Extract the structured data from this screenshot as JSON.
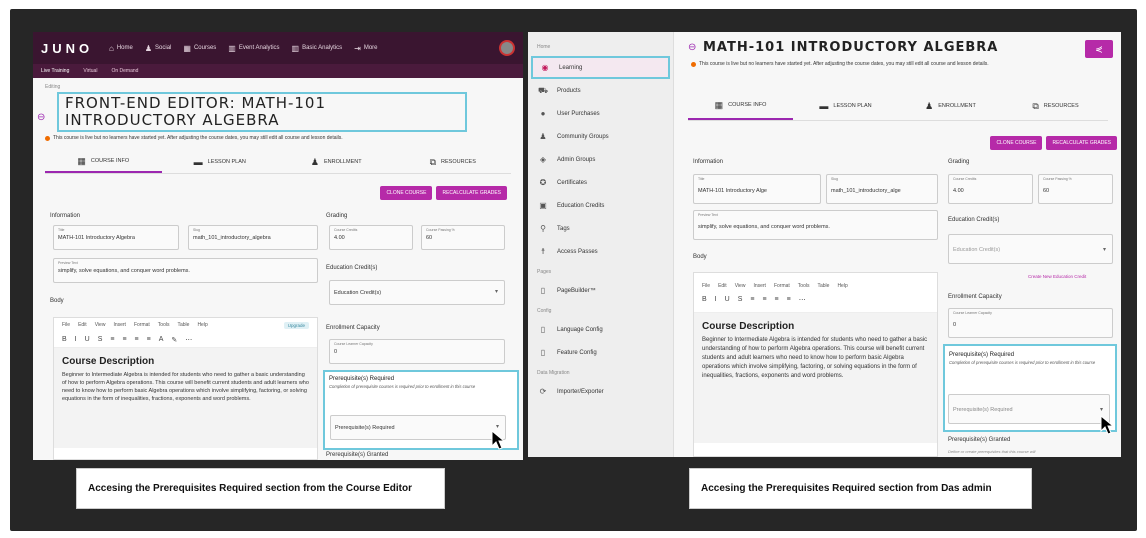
{
  "left": {
    "logo": "JUNO",
    "nav": [
      {
        "icon": "home-icon",
        "glyph": "⌂",
        "label": "Home"
      },
      {
        "icon": "people-icon",
        "glyph": "♟",
        "label": "Social"
      },
      {
        "icon": "calendar-icon",
        "glyph": "▦",
        "label": "Courses"
      },
      {
        "icon": "chart-icon",
        "glyph": "▥",
        "label": "Event Analytics"
      },
      {
        "icon": "bar-icon",
        "glyph": "▥",
        "label": "Basic Analytics"
      },
      {
        "icon": "more-icon",
        "glyph": "⇥",
        "label": "More"
      }
    ],
    "subnav": [
      "Live Training",
      "Virtual",
      "On Demand"
    ],
    "editing_label": "Editing",
    "title": "FRONT-END EDITOR: MATH-101 INTRODUCTORY ALGEBRA",
    "notice": "This course is live but no learners have started yet. After adjusting the course dates, you may still edit all course and lesson details.",
    "tabs": [
      "COURSE INFO",
      "LESSON PLAN",
      "ENROLLMENT",
      "RESOURCES"
    ],
    "buttons": {
      "clone": "CLONE COURSE",
      "recalc": "RECALCULATE GRADES"
    },
    "information": "Information",
    "title_field": {
      "label": "Title",
      "value": "MATH-101 Introductory Algebra"
    },
    "slug_field": {
      "label": "Slug",
      "value": "math_101_introductory_algebra"
    },
    "preview_field": {
      "label": "Preview Text",
      "value": "simplify, solve equations, and conquer word problems."
    },
    "body": "Body",
    "menubar": [
      "File",
      "Edit",
      "View",
      "Insert",
      "Format",
      "Tools",
      "Table",
      "Help"
    ],
    "upgrade": "Upgrade",
    "cd_title": "Course Description",
    "cd_text": "Beginner to Intermediate Algebra is intended for students who need to gather a basic understanding of how to perform Algebra operations. This course will benefit current students and adult learners who need to know how to perform basic Algebra operations which involve simplifying, factoring, or solving equations in the form of inequalities, fractions, exponents and word problems.",
    "grading": "Grading",
    "credits_field": {
      "label": "Course Credits",
      "value": "4.00"
    },
    "passing_field": {
      "label": "Course Passing %",
      "value": "60"
    },
    "edu_credits": "Education Credit(s)",
    "edu_select": "Education Credit(s)",
    "enroll_capacity": "Enrollment Capacity",
    "capacity_field": {
      "label": "Course Learner Capacity",
      "value": "0"
    },
    "prereq_title": "Prerequisite(s) Required",
    "prereq_desc": "Completion of prerequisite courses is required prior to enrollment in this course",
    "prereq_select": "Prerequisite(s) Required",
    "prereq_granted": "Prerequisite(s) Granted"
  },
  "right": {
    "side_home": "Home",
    "side_items": [
      {
        "icon": "learning-icon",
        "glyph": "◉",
        "label": "Learning",
        "active": true
      },
      {
        "icon": "cart-icon",
        "glyph": "⛟",
        "label": "Products"
      },
      {
        "icon": "user-icon",
        "glyph": "●",
        "label": "User Purchases"
      },
      {
        "icon": "group-icon",
        "glyph": "♟",
        "label": "Community Groups"
      },
      {
        "icon": "admin-icon",
        "glyph": "◈",
        "label": "Admin Groups"
      },
      {
        "icon": "certificate-icon",
        "glyph": "✪",
        "label": "Certificates"
      },
      {
        "icon": "credits-icon",
        "glyph": "▣",
        "label": "Education Credits"
      },
      {
        "icon": "tag-icon",
        "glyph": "⚲",
        "label": "Tags"
      },
      {
        "icon": "pass-icon",
        "glyph": "☨",
        "label": "Access Passes"
      }
    ],
    "side_pages": "Pages",
    "side_pagebuilder": "PageBuilder™",
    "side_config": "Config",
    "side_config_items": [
      "Language Config",
      "Feature Config"
    ],
    "side_migration": "Data Migration",
    "side_importer": "Importer/Exporter",
    "title": "MATH-101 INTRODUCTORY ALGEBRA",
    "notice": "This course is live but no learners have started yet. After adjusting the course dates, you may still edit all course and lesson details.",
    "tabs": [
      "COURSE INFO",
      "LESSON PLAN",
      "ENROLLMENT",
      "RESOURCES"
    ],
    "buttons": {
      "clone": "CLONE COURSE",
      "recalc": "RECALCULATE GRADES"
    },
    "information": "Information",
    "title_field": {
      "label": "Title",
      "value": "MATH-101 Introductory Alge"
    },
    "slug_field": {
      "label": "Slug",
      "value": "math_101_introductory_alge"
    },
    "preview_field": {
      "label": "Preview Text",
      "value": "simplify, solve equations, and conquer word problems."
    },
    "body": "Body",
    "menubar": [
      "File",
      "Edit",
      "View",
      "Insert",
      "Format",
      "Tools",
      "Table",
      "Help"
    ],
    "cd_title": "Course Description",
    "cd_text": "Beginner to Intermediate Algebra is intended for students who need to gather a basic understanding of how to perform Algebra operations. This course will benefit current students and adult learners who need to know how to perform basic Algebra operations which involve simplifying, factoring, or solving equations in the form of inequalities, fractions, exponents and word problems.",
    "grading": "Grading",
    "credits_field": {
      "label": "Course Credits",
      "value": "4.00"
    },
    "passing_field": {
      "label": "Course Passing %",
      "value": "60"
    },
    "edu_credits": "Education Credit(s)",
    "edu_select": "Education Credit(s)",
    "create_credit": "Create New Education Credit",
    "enroll_capacity": "Enrollment Capacity",
    "capacity_field": {
      "label": "Course Learner Capacity",
      "value": "0"
    },
    "prereq_title": "Prerequisite(s) Required",
    "prereq_desc": "Completion of prerequisite courses is required prior to enrollment in this course",
    "prereq_select": "Prerequisite(s) Required",
    "prereq_granted": "Prerequisite(s) Granted",
    "prereq_granted_desc": "Define or create prerequisites that this course will"
  },
  "captions": {
    "left": "Accesing the Prerequisites Required section from the Course Editor",
    "right": "Accesing the Prerequisites Required section from Das admin"
  },
  "colors": {
    "brand": "#b62aa8",
    "highlight": "#6fc8dc",
    "nav_bg": "#3a1530"
  }
}
